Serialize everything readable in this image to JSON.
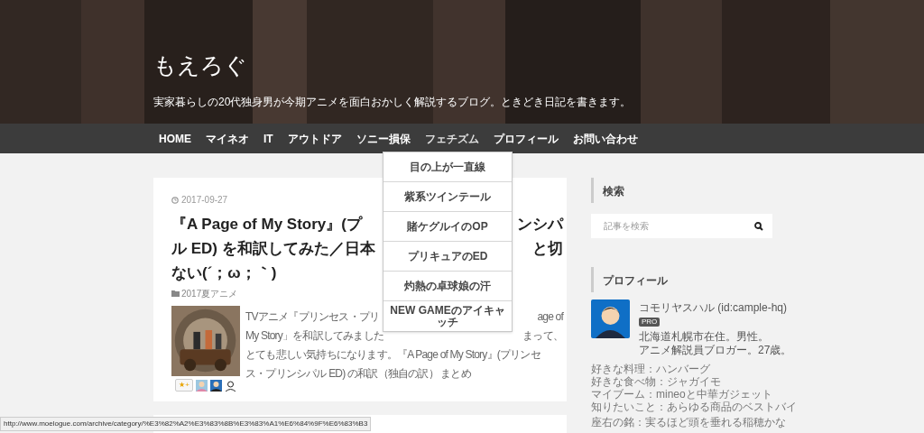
{
  "header": {
    "title": "もえろぐ",
    "tagline": "実家暮らしの20代独身男が今期アニメを面白おかしく解説するブログ。ときどき日記を書きます。"
  },
  "nav": {
    "items": [
      {
        "label": "HOME"
      },
      {
        "label": "マイネオ"
      },
      {
        "label": "IT"
      },
      {
        "label": "アウトドア"
      },
      {
        "label": "ソニー損保"
      },
      {
        "label": "フェチズム",
        "expanded": true
      },
      {
        "label": "プロフィール"
      },
      {
        "label": "お問い合わせ"
      }
    ],
    "dropdown": [
      "目の上が一直線",
      "紫系ツインテール",
      "賭ケグルイのOP",
      "プリキュアのED",
      "灼熱の卓球娘の汗",
      "NEW GAMEのアイキャッチ"
    ]
  },
  "article": {
    "date": "2017-09-27",
    "title_lines": [
      {
        "left": "『A Page of My Story』(プ",
        "right": "ンシパ"
      },
      {
        "left": "ル ED) を和訳してみた／日本",
        "right": "と切"
      },
      {
        "left": "ない(´；ω；｀)"
      }
    ],
    "category": "2017夏アニメ",
    "excerpt_lines": [
      {
        "left": "TVアニメ『プリンセス・プリ",
        "right": "age of"
      },
      {
        "left": "My Story」を和訳してみました",
        "right": "まって、"
      },
      {
        "left": "とても悲しい気持ちになります。『A Page of My Story』(プリンセ"
      },
      {
        "left": "ス・プリンシパル ED) の和訳（独自の訳） まとめ"
      }
    ],
    "star_button": "★+"
  },
  "sidebar": {
    "search": {
      "heading": "検索",
      "placeholder": "記事を検索"
    },
    "profile": {
      "heading": "プロフィール",
      "name": "コモリヤスハル (id:cample-hq)",
      "badge": "PRO",
      "bio": [
        "北海道札幌市在住。男性。",
        "アニメ解説員ブロガー。27歳。"
      ],
      "facts": [
        "好きな料理：ハンバーグ",
        "好きな食べ物：ジャガイモ",
        "マイブーム：mineoと中華ガジェット",
        "知りたいこと：あらゆる商品のベストバイ"
      ],
      "motto": "座右の銘：実るほど頭を垂れる稲穂かな"
    }
  },
  "status_bar": "http://www.moelogue.com/archive/category/%E3%82%A2%E3%83%8B%E3%83%A1%E6%84%9F%E6%83%B3"
}
